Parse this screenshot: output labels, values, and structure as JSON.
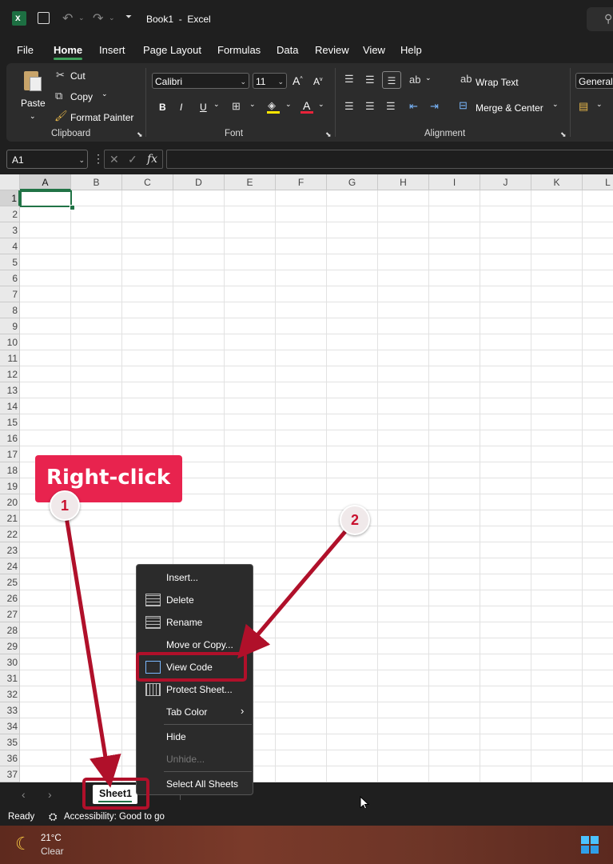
{
  "window": {
    "title": "Book1  -  Excel"
  },
  "menu_tabs": [
    "File",
    "Home",
    "Insert",
    "Page Layout",
    "Formulas",
    "Data",
    "Review",
    "View",
    "Help"
  ],
  "ribbon": {
    "clipboard": {
      "paste": "Paste",
      "cut": "Cut",
      "copy": "Copy",
      "format_painter": "Format Painter",
      "label": "Clipboard"
    },
    "font": {
      "name": "Calibri",
      "size": "11",
      "bold": "B",
      "italic": "I",
      "underline": "U",
      "label": "Font"
    },
    "alignment": {
      "wrap_text": "Wrap Text",
      "merge_center": "Merge & Center",
      "label": "Alignment"
    },
    "number": {
      "format": "General"
    }
  },
  "formula_bar": {
    "name_box": "A1",
    "fx": "fx",
    "value": ""
  },
  "grid": {
    "columns": [
      "A",
      "B",
      "C",
      "D",
      "E",
      "F",
      "G",
      "H",
      "I",
      "J",
      "K",
      "L"
    ],
    "rows": [
      "1",
      "2",
      "3",
      "4",
      "5",
      "6",
      "7",
      "8",
      "9",
      "10",
      "11",
      "12",
      "13",
      "14",
      "15",
      "16",
      "17",
      "18",
      "19",
      "20",
      "21",
      "22",
      "23",
      "24",
      "25",
      "26",
      "27",
      "28",
      "29",
      "30",
      "31",
      "32",
      "33",
      "34",
      "35",
      "36",
      "37"
    ],
    "selected_cell": "A1"
  },
  "sheet_tabs": [
    "Sheet1"
  ],
  "status": {
    "ready": "Ready",
    "accessibility": "Accessibility: Good to go"
  },
  "taskbar": {
    "temperature": "21°C",
    "condition": "Clear"
  },
  "context_menu": {
    "insert": "Insert...",
    "delete": "Delete",
    "rename": "Rename",
    "move_copy": "Move or Copy...",
    "view_code": "View Code",
    "protect_sheet": "Protect Sheet...",
    "tab_color": "Tab Color",
    "hide": "Hide",
    "unhide": "Unhide...",
    "select_all": "Select All Sheets"
  },
  "annotations": {
    "callout": "Right-click",
    "step1": "1",
    "step2": "2"
  },
  "colors": {
    "accent_green": "#217346",
    "annotation_red": "#b0102a",
    "callout_bg": "#e8234e"
  }
}
